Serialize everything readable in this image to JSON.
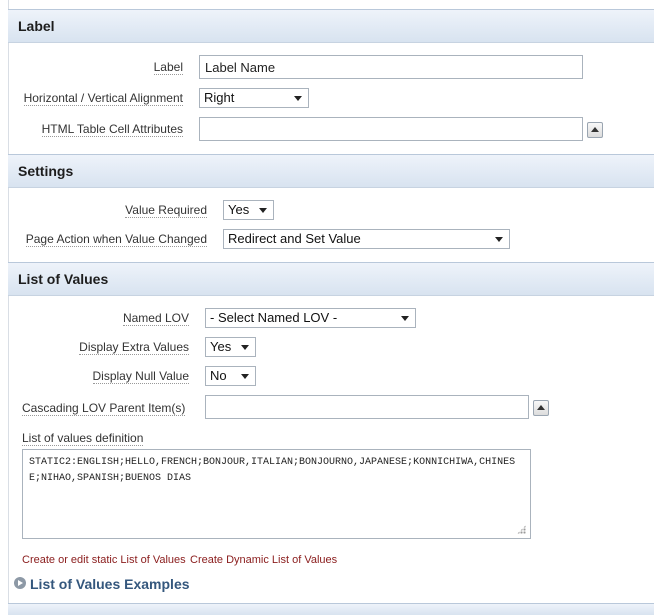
{
  "label_section": {
    "title": "Label",
    "label_field": {
      "label": "Label",
      "value": "Label Name"
    },
    "alignment": {
      "label": "Horizontal / Vertical Alignment",
      "value": "Right"
    },
    "cell_attributes": {
      "label": "HTML Table Cell Attributes",
      "value": ""
    }
  },
  "settings_section": {
    "title": "Settings",
    "value_required": {
      "label": "Value Required",
      "value": "Yes"
    },
    "page_action": {
      "label": "Page Action when Value Changed",
      "value": "Redirect and Set Value"
    }
  },
  "lov_section": {
    "title": "List of Values",
    "named_lov": {
      "label": "Named LOV",
      "value": "- Select Named LOV -"
    },
    "display_extra": {
      "label": "Display Extra Values",
      "value": "Yes"
    },
    "display_null": {
      "label": "Display Null Value",
      "value": "No"
    },
    "cascading_parent": {
      "label": "Cascading LOV Parent Item(s)",
      "value": ""
    },
    "definition": {
      "label": "List of values definition",
      "value": "STATIC2:ENGLISH;HELLO,FRENCH;BONJOUR,ITALIAN;BONJOURNO,JAPANESE;KONNICHIWA,CHINESE;NIHAO,SPANISH;BUENOS DIAS"
    },
    "links": {
      "static": "Create or edit static List of Values",
      "dynamic": "Create Dynamic List of Values"
    },
    "examples": "List of Values Examples"
  }
}
